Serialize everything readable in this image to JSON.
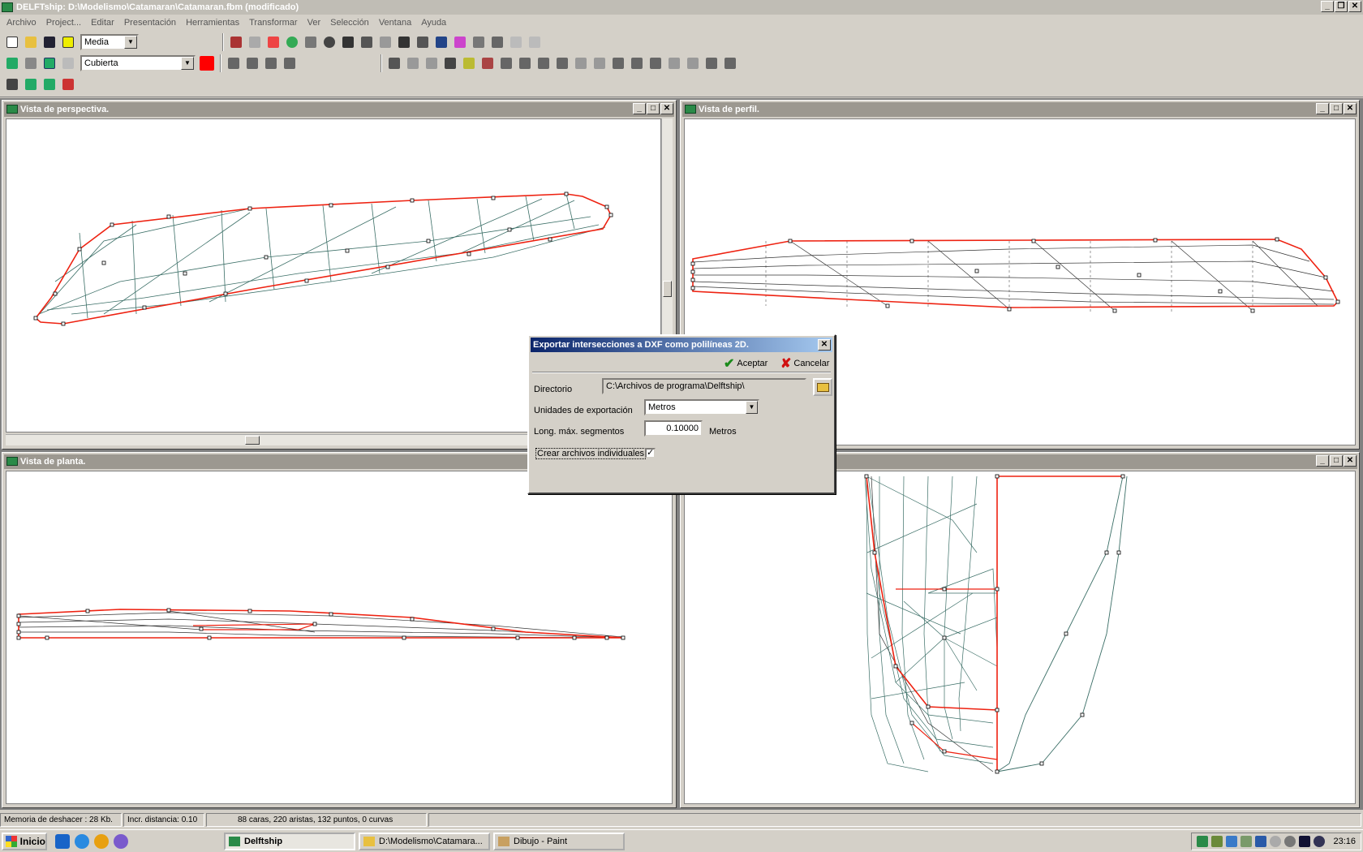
{
  "window": {
    "title": "DELFTship: D:\\Modelismo\\Catamaran\\Catamaran.fbm (modificado)"
  },
  "menu": [
    "Archivo",
    "Project...",
    "Editar",
    "Presentación",
    "Herramientas",
    "Transformar",
    "Ver",
    "Selección",
    "Ventana",
    "Ayuda"
  ],
  "toolbar": {
    "precision_value": "Media",
    "layer_value": "Cubierta",
    "layer_color": "#ff0000"
  },
  "views": {
    "perspective": "Vista de perspectiva.",
    "profile": "Vista de perfil.",
    "plan": "Vista de planta.",
    "bodyplan": ""
  },
  "dialog": {
    "title": "Exportar intersecciones a DXF como polilíneas 2D.",
    "ok_label": "Aceptar",
    "cancel_label": "Cancelar",
    "dir_label": "Directorio",
    "dir_value": "C:\\Archivos de programa\\Delftship\\",
    "units_label": "Unidades de exportación",
    "units_value": "Metros",
    "seg_label": "Long. máx. segmentos",
    "seg_value": "0.10000",
    "seg_unit": "Metros",
    "individual_label": "Crear archivos individuales",
    "individual_checked": "✓"
  },
  "status": {
    "undo": "Memoria de deshacer : 28 Kb.",
    "incr": "Incr. distancia: 0.10",
    "counts": "88 caras, 220 aristas, 132 puntos, 0 curvas"
  },
  "taskbar": {
    "start": "Inicio",
    "tasks": [
      "Delftship",
      "D:\\Modelismo\\Catamara...",
      "Dibujo - Paint"
    ],
    "clock": "23:16"
  }
}
